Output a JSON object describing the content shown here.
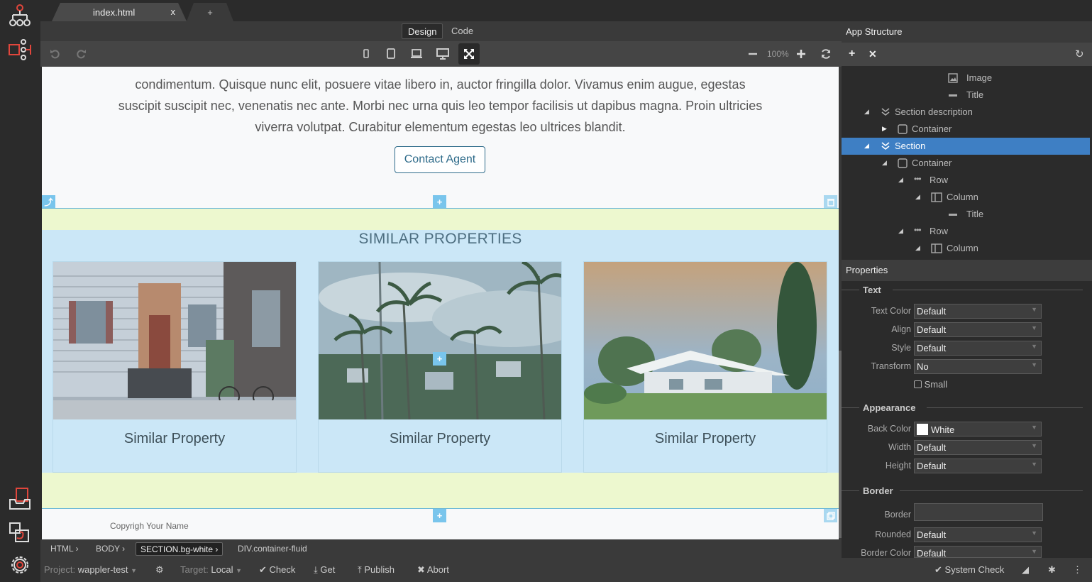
{
  "tabs": {
    "active_label": "index.html",
    "close": "x",
    "new_tab": "+"
  },
  "modes": {
    "design": "Design",
    "code": "Code",
    "active": "Design"
  },
  "toolbar": {
    "zoom": "100%"
  },
  "page": {
    "intro_text": "condimentum. Quisque nunc elit, posuere vitae libero in, auctor fringilla dolor. Vivamus enim augue, egestas suscipit suscipit nec, venenatis nec ante. Morbi nec urna quis leo tempor facilisis ut dapibus magna. Proin ultricies viverra volutpat. Curabitur elementum egestas leo ultrices blandit.",
    "contact_button": "Contact Agent",
    "section_title": "SIMILAR PROPERTIES",
    "cards": [
      {
        "caption": "Similar Property"
      },
      {
        "caption": "Similar Property"
      },
      {
        "caption": "Similar Property"
      }
    ],
    "copyright": "Copyrigh Your Name"
  },
  "breadcrumb": [
    {
      "label": "HTML"
    },
    {
      "label": "BODY"
    },
    {
      "label": "SECTION.bg-white"
    },
    {
      "label": "DIV.container-fluid"
    }
  ],
  "status": {
    "project_label": "Project:",
    "project_value": "wappler-test",
    "target_label": "Target:",
    "target_value": "Local",
    "check": "Check",
    "get": "Get",
    "publish": "Publish",
    "abort": "Abort",
    "system_check": "System Check"
  },
  "app_structure": {
    "title": "App Structure",
    "tree": [
      {
        "label": "Image",
        "icon": "image-icon"
      },
      {
        "label": "Title",
        "icon": "title-icon"
      },
      {
        "label": "Section description",
        "icon": "section-icon"
      },
      {
        "label": "Container",
        "icon": "container-icon"
      },
      {
        "label": "Section",
        "icon": "section-icon",
        "selected": true
      },
      {
        "label": "Container",
        "icon": "container-icon"
      },
      {
        "label": "Row",
        "icon": "row-icon"
      },
      {
        "label": "Column",
        "icon": "column-icon"
      },
      {
        "label": "Title",
        "icon": "title-icon"
      },
      {
        "label": "Row",
        "icon": "row-icon"
      },
      {
        "label": "Column",
        "icon": "column-icon"
      }
    ]
  },
  "properties": {
    "title": "Properties",
    "text_group": "Text",
    "text_color_label": "Text Color",
    "text_color": "Default",
    "align_label": "Align",
    "align": "Default",
    "style_label": "Style",
    "style": "Default",
    "transform_label": "Transform",
    "transform": "No",
    "small_label": "Small",
    "appearance_group": "Appearance",
    "back_color_label": "Back Color",
    "back_color": "White",
    "width_label": "Width",
    "width": "Default",
    "height_label": "Height",
    "height": "Default",
    "border_group": "Border",
    "border_label": "Border",
    "border": "",
    "rounded_label": "Rounded",
    "rounded": "Default",
    "border_color_label": "Border Color",
    "border_color": "Default"
  },
  "colors": {
    "accent": "#3e7fc4",
    "brand_red": "#e0463c",
    "section_bg": "#cbe7f7",
    "padding_bg": "#edf8cf"
  }
}
